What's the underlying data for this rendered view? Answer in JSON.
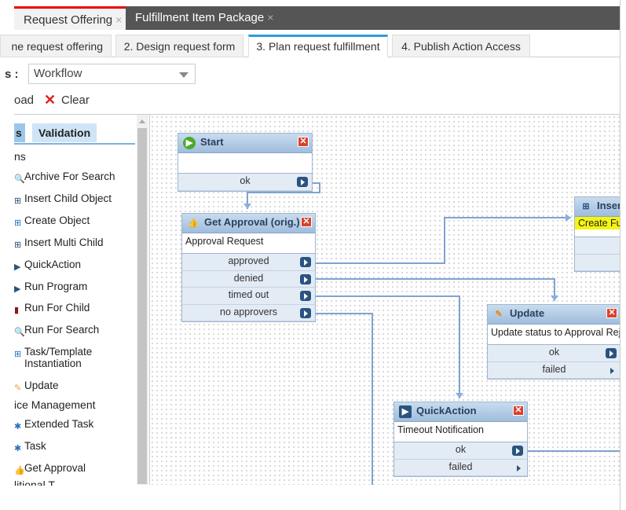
{
  "doc_tabs": [
    {
      "label": "Request Offering",
      "close": "×"
    },
    {
      "label": "Fulfillment Item Package",
      "close": "×"
    }
  ],
  "steps": [
    "ne request offering",
    "2. Design request form",
    "3. Plan request fulfillment",
    "4. Publish Action Access"
  ],
  "active_step": 2,
  "selector": {
    "label": "s :",
    "value": "Workflow"
  },
  "toolbar": {
    "load": "oad",
    "clear": "Clear"
  },
  "palette": {
    "tabs": [
      "s",
      "Validation"
    ],
    "items": [
      {
        "label": "ns",
        "icon": "none",
        "heading": true
      },
      {
        "label": "Archive For Search",
        "icon": "search-run-icon"
      },
      {
        "label": "Insert Child Object",
        "icon": "insert-child-icon"
      },
      {
        "label": "Create Object",
        "icon": "create-object-icon"
      },
      {
        "label": "Insert Multi Child",
        "icon": "insert-child-icon"
      },
      {
        "label": "QuickAction",
        "icon": "play-icon"
      },
      {
        "label": "Run Program",
        "icon": "play-icon"
      },
      {
        "label": "Run For Child",
        "icon": "run-child-icon"
      },
      {
        "label": "Run For Search",
        "icon": "search-run-icon"
      },
      {
        "label": "Task/Template\nInstantiation",
        "icon": "task-template-icon"
      },
      {
        "label": "Update",
        "icon": "pencil-icon"
      },
      {
        "label": "ice Management",
        "icon": "none",
        "heading": true
      },
      {
        "label": "Extended Task",
        "icon": "gear-icon"
      },
      {
        "label": "Task",
        "icon": "gear-icon"
      },
      {
        "label": "Get Approval",
        "icon": "thumbs-up-icon"
      },
      {
        "label": "litional T...",
        "icon": "none",
        "heading": true
      }
    ]
  },
  "nodes": [
    {
      "id": "start",
      "title": "Start",
      "icon": "start-icon",
      "body": "",
      "ports": [
        "ok"
      ]
    },
    {
      "id": "get-approval",
      "title": "Get Approval (orig.)",
      "icon": "thumbs-up-icon",
      "body": "Approval Request",
      "ports": [
        "approved",
        "denied",
        "timed out",
        "no approvers"
      ]
    },
    {
      "id": "insert",
      "title": "Insert",
      "icon": "insert-child-icon",
      "body": "Create Fulf",
      "highlight": true,
      "ports": [
        "",
        ""
      ]
    },
    {
      "id": "update",
      "title": "Update",
      "icon": "pencil-icon",
      "body": "Update status to Approval Reject",
      "ports": [
        "ok",
        "failed"
      ]
    },
    {
      "id": "quickaction",
      "title": "QuickAction",
      "icon": "play-icon",
      "body": "Timeout Notification",
      "ports": [
        "ok",
        "failed"
      ]
    }
  ],
  "colors": {
    "accent": "#2a9fd8",
    "active_doc": "#e00000",
    "wire": "#7fa3d0",
    "highlight": "#f5f510"
  }
}
